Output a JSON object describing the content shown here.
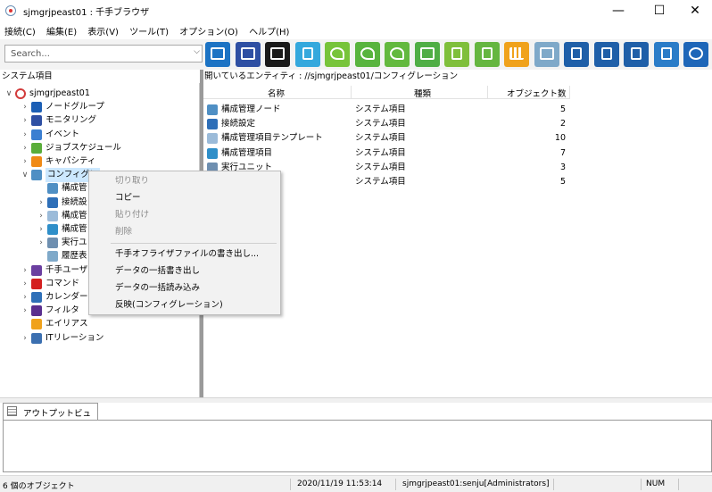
{
  "window": {
    "title": "sjmgrjpeast01 : 千手ブラウザ",
    "icon": "senju-app-icon",
    "buttons": {
      "minimize": "—",
      "maximize": "☐",
      "close": "✕"
    }
  },
  "menubar": [
    "接続(C)",
    "編集(E)",
    "表示(V)",
    "ツール(T)",
    "オプション(O)",
    "ヘルプ(H)"
  ],
  "toolbar": {
    "search_placeholder": "Search...",
    "buttons": [
      {
        "name": "node-group-tb-icon",
        "color": "#1c73c4",
        "glyph": "box"
      },
      {
        "name": "monitoring-tb-icon",
        "color": "#2e4fa3",
        "glyph": "box"
      },
      {
        "name": "monitor-dark-tb-icon",
        "color": "#1a1a1a",
        "glyph": "box"
      },
      {
        "name": "message-tb-icon",
        "color": "#34a8dd",
        "glyph": "doc"
      },
      {
        "name": "leaf-tb-icon",
        "color": "#77c43a",
        "glyph": "leaf"
      },
      {
        "name": "check-leaf-tb-icon",
        "color": "#58b43e",
        "glyph": "leaf"
      },
      {
        "name": "sync-leaf-tb-icon",
        "color": "#63b93e",
        "glyph": "leaf"
      },
      {
        "name": "monitor-check-tb-icon",
        "color": "#4fae45",
        "glyph": "box"
      },
      {
        "name": "report-tb-icon",
        "color": "#7fbf3b",
        "glyph": "doc"
      },
      {
        "name": "list-tb-icon",
        "color": "#65b640",
        "glyph": "doc"
      },
      {
        "name": "chart-tb-icon",
        "color": "#f0a21c",
        "glyph": "bars"
      },
      {
        "name": "puzzle-tb-icon",
        "color": "#7fa9c9",
        "glyph": "box"
      },
      {
        "name": "export-tb-icon",
        "color": "#1f5fa8",
        "glyph": "doc"
      },
      {
        "name": "import-tb-icon",
        "color": "#1f5fa8",
        "glyph": "doc"
      },
      {
        "name": "deploy-tb-icon",
        "color": "#1f5fa8",
        "glyph": "doc"
      },
      {
        "name": "log-tb-icon",
        "color": "#2a7cc8",
        "glyph": "doc"
      },
      {
        "name": "radar-tb-icon",
        "color": "#1e66b8",
        "glyph": "target"
      }
    ]
  },
  "left_pane": {
    "header": "システム項目",
    "tree": [
      {
        "label": "sjmgrjpeast01",
        "depth": 0,
        "expander": "open",
        "icon": "globe-icon",
        "color": "#d23b3b"
      },
      {
        "label": "ノードグループ",
        "depth": 1,
        "expander": "closed",
        "icon": "node-group-icon",
        "color": "#1c5fb5"
      },
      {
        "label": "モニタリング",
        "depth": 1,
        "expander": "closed",
        "icon": "monitor-icon",
        "color": "#2e4fa3"
      },
      {
        "label": "イベント",
        "depth": 1,
        "expander": "closed",
        "icon": "event-icon",
        "color": "#3b7fd1"
      },
      {
        "label": "ジョブスケジュール",
        "depth": 1,
        "expander": "closed",
        "icon": "job-schedule-icon",
        "color": "#5aad3a"
      },
      {
        "label": "キャパシティ",
        "depth": 1,
        "expander": "closed",
        "icon": "capacity-icon",
        "color": "#f08a16"
      },
      {
        "label": "コンフィグレ",
        "depth": 1,
        "expander": "open",
        "icon": "configuration-icon",
        "color": "#4f8fc4",
        "selected": true
      },
      {
        "label": "構成管",
        "depth": 2,
        "expander": "none",
        "icon": "config-node-icon",
        "color": "#4f8fc4"
      },
      {
        "label": "接続設",
        "depth": 2,
        "expander": "closed",
        "icon": "link-icon",
        "color": "#2e6fb8"
      },
      {
        "label": "構成管",
        "depth": 2,
        "expander": "closed",
        "icon": "config-template-icon",
        "color": "#9bbbd9"
      },
      {
        "label": "構成管",
        "depth": 2,
        "expander": "closed",
        "icon": "config-item-icon",
        "color": "#2f8fc9"
      },
      {
        "label": "実行ユ",
        "depth": 2,
        "expander": "closed",
        "icon": "exec-unit-icon",
        "color": "#6e8fb0"
      },
      {
        "label": "履歴表",
        "depth": 2,
        "expander": "none",
        "icon": "history-icon",
        "color": "#7fa9c9"
      },
      {
        "label": "千手ユーザ",
        "depth": 1,
        "expander": "closed",
        "icon": "user-icon",
        "color": "#6b3fa0"
      },
      {
        "label": "コマンド",
        "depth": 1,
        "expander": "closed",
        "icon": "command-icon",
        "color": "#d42020"
      },
      {
        "label": "カレンダー",
        "depth": 1,
        "expander": "closed",
        "icon": "calendar-icon",
        "color": "#2e6fb8"
      },
      {
        "label": "フィルタ",
        "depth": 1,
        "expander": "closed",
        "icon": "filter-icon",
        "color": "#5a2f8f"
      },
      {
        "label": "エイリアス",
        "depth": 1,
        "expander": "none",
        "icon": "alias-icon",
        "color": "#f0a21c"
      },
      {
        "label": "ITリレーション",
        "depth": 1,
        "expander": "closed",
        "icon": "it-relation-icon",
        "color": "#3b6fb0"
      }
    ]
  },
  "right_pane": {
    "header": "開いているエンティティ : //sjmgrjpeast01/コンフィグレーション",
    "columns": [
      "名称",
      "種類",
      "オブジェクト数"
    ],
    "rows": [
      {
        "name": "構成管理ノード",
        "type": "システム項目",
        "count": "5",
        "icon": "config-node-icon",
        "color": "#4f8fc4"
      },
      {
        "name": "接続設定",
        "type": "システム項目",
        "count": "2",
        "icon": "link-icon",
        "color": "#2e6fb8"
      },
      {
        "name": "構成管理項目テンプレート",
        "type": "システム項目",
        "count": "10",
        "icon": "config-template-icon",
        "color": "#9bbbd9"
      },
      {
        "name": "構成管理項目",
        "type": "システム項目",
        "count": "7",
        "icon": "config-item-icon",
        "color": "#2f8fc9"
      },
      {
        "name": "実行ユニット",
        "type": "システム項目",
        "count": "3",
        "icon": "exec-unit-icon",
        "color": "#6e8fb0"
      },
      {
        "name": "",
        "type": "システム項目",
        "count": "5",
        "icon": "history-icon",
        "color": "#7fa9c9"
      }
    ]
  },
  "context_menu": {
    "items": [
      {
        "label": "切り取り",
        "enabled": false
      },
      {
        "label": "コピー",
        "enabled": true
      },
      {
        "label": "貼り付け",
        "enabled": false
      },
      {
        "label": "削除",
        "enabled": false
      },
      {
        "label": "千手オフライザファイルの書き出し...",
        "enabled": true
      },
      {
        "label": "データの一括書き出し",
        "enabled": true
      },
      {
        "label": "データの一括読み込み",
        "enabled": true
      },
      {
        "label": "反映(コンフィグレーション)",
        "enabled": true
      }
    ]
  },
  "output": {
    "tab_label": "アウトプットビュー"
  },
  "statusbar": {
    "objects": "6 個のオブジェクト",
    "datetime": "2020/11/19 11:53:14",
    "user": "sjmgrjpeast01:senju[Administrators]",
    "num": "NUM"
  }
}
